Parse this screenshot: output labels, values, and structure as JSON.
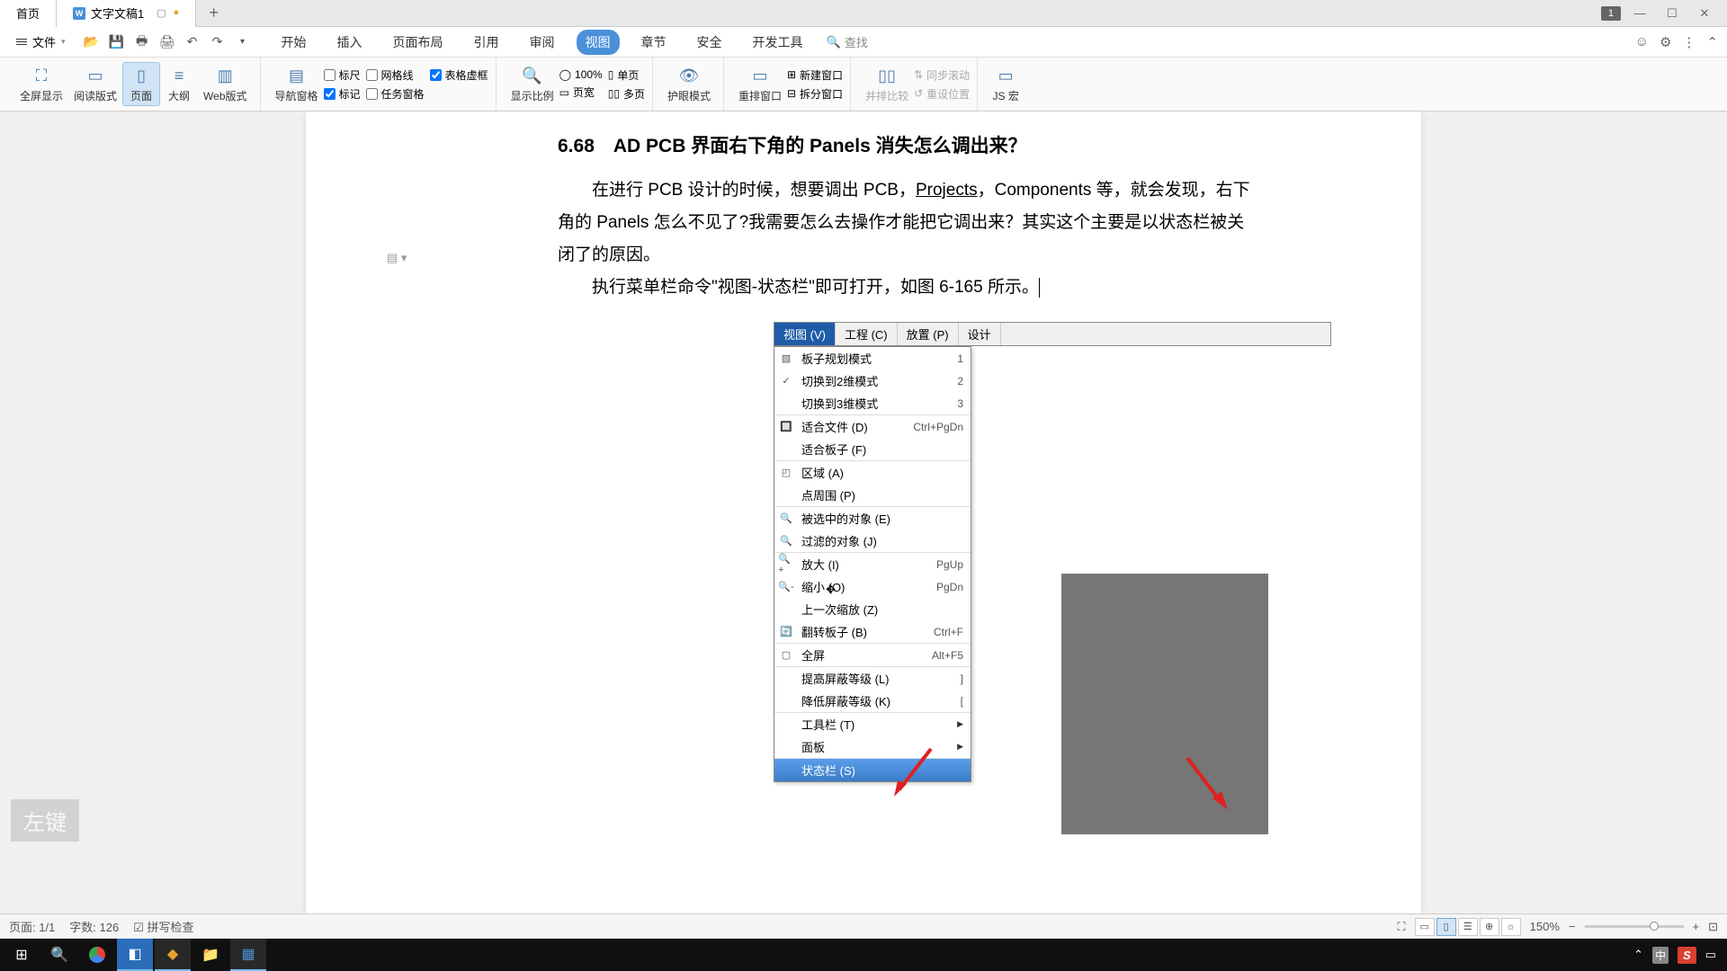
{
  "titlebar": {
    "home_tab": "首页",
    "doc_tab": "文字文稿1",
    "badge": "1"
  },
  "menubar": {
    "file": "文件",
    "tabs": [
      "开始",
      "插入",
      "页面布局",
      "引用",
      "审阅",
      "视图",
      "章节",
      "安全",
      "开发工具"
    ],
    "active_tab": "视图",
    "search": "查找"
  },
  "ribbon": {
    "full_screen": "全屏显示",
    "read_layout": "阅读版式",
    "page_view": "页面",
    "outline": "大纲",
    "web_view": "Web版式",
    "nav_pane": "导航窗格",
    "ruler": "标尺",
    "gridlines": "网格线",
    "markup": "标记",
    "table_dash": "表格虚框",
    "task_pane": "任务窗格",
    "zoom_ratio": "显示比例",
    "pct100": "100%",
    "page_width": "页宽",
    "single_page": "单页",
    "multi_page": "多页",
    "eye_mode": "护眼模式",
    "rearrange": "重排窗口",
    "new_window": "新建窗口",
    "split_window": "拆分窗口",
    "side_by_side": "并排比较",
    "sync_scroll": "同步滚动",
    "reset_pos": "重设位置",
    "js_macro": "JS 宏"
  },
  "document": {
    "heading": "6.68　AD PCB 界面右下角的 Panels 消失怎么调出来？",
    "p1_a": "在进行 PCB 设计的时候，想要调出 PCB，",
    "p1_projects": "Projects",
    "p1_b": "，Components 等，就会发现，右下角的 Panels 怎么不见了?我需要怎么去操作才能把它调出来？其实这个主要是以状态栏被关闭了的原因。",
    "p2": "执行菜单栏命令\"视图-状态栏\"即可打开，如图 6-165 所示。"
  },
  "embedded_menu": {
    "menubar": [
      {
        "label": "视图 (V)",
        "active": true
      },
      {
        "label": "工程 (C)"
      },
      {
        "label": "放置 (P)"
      },
      {
        "label": "设计"
      }
    ],
    "items": [
      {
        "icon": "board",
        "label": "板子规划模式",
        "key": "1"
      },
      {
        "icon": "check",
        "label": "切换到2维模式",
        "key": "2"
      },
      {
        "icon": "",
        "label": "切换到3维模式",
        "key": "3",
        "sep": false
      },
      {
        "icon": "fit",
        "label": "适合文件 (D)",
        "key": "Ctrl+PgDn",
        "sep": true
      },
      {
        "icon": "",
        "label": "适合板子 (F)",
        "key": ""
      },
      {
        "icon": "area",
        "label": "区域 (A)",
        "key": "",
        "sep": true
      },
      {
        "icon": "",
        "label": "点周围 (P)",
        "key": ""
      },
      {
        "icon": "sel",
        "label": "被选中的对象 (E)",
        "key": "",
        "sep": true
      },
      {
        "icon": "filt",
        "label": "过滤的对象 (J)",
        "key": ""
      },
      {
        "icon": "zi",
        "label": "放大 (I)",
        "key": "PgUp",
        "sep": true
      },
      {
        "icon": "zo",
        "label": "缩小 (O)",
        "key": "PgDn"
      },
      {
        "icon": "",
        "label": "上一次缩放 (Z)",
        "key": ""
      },
      {
        "icon": "flip",
        "label": "翻转板子 (B)",
        "key": "Ctrl+F"
      },
      {
        "icon": "fs",
        "label": "全屏",
        "key": "Alt+F5",
        "sep": true
      },
      {
        "icon": "",
        "label": "提高屏蔽等级 (L)",
        "key": "]",
        "sep": true
      },
      {
        "icon": "",
        "label": "降低屏蔽等级 (K)",
        "key": "["
      },
      {
        "icon": "",
        "label": "工具栏 (T)",
        "key": "",
        "arrow": true,
        "sep": true
      },
      {
        "icon": "",
        "label": "面板",
        "key": "",
        "arrow": true
      },
      {
        "icon": "",
        "label": "状态栏 (S)",
        "key": "",
        "highlight": true,
        "sep": true
      }
    ]
  },
  "watermark": "左键",
  "statusbar": {
    "page": "页面: 1/1",
    "words": "字数: 126",
    "spell": "拼写检查",
    "zoom": "150%"
  },
  "taskbar": {
    "ime_cn": "中",
    "ime_s": "S"
  }
}
